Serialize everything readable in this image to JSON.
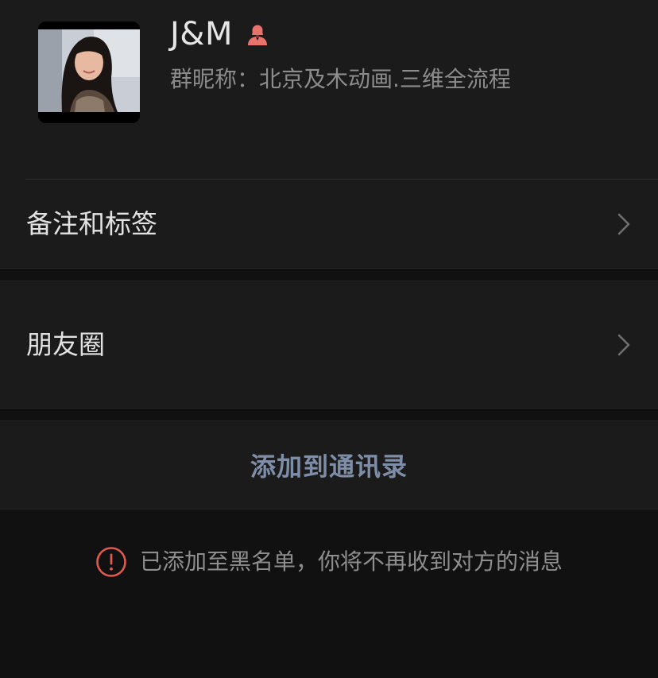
{
  "profile": {
    "name": "J&M",
    "nickname": "群昵称：北京及木动画.三维全流程",
    "avatar_icon": "avatar-photo",
    "gender_icon": "female-icon",
    "gender_color": "#e8736c"
  },
  "cells": {
    "remarks_label": "备注和标签",
    "moments_label": "朋友圈"
  },
  "actions": {
    "add_to_contacts_label": "添加到通讯录"
  },
  "notice": {
    "icon": "warning-icon",
    "icon_color": "#e05a4f",
    "text": "已添加至黑名单，你将不再收到对方的消息"
  },
  "colors": {
    "background": "#111111",
    "cell_background": "#1b1b1b",
    "action_text": "#7f8ea8"
  }
}
